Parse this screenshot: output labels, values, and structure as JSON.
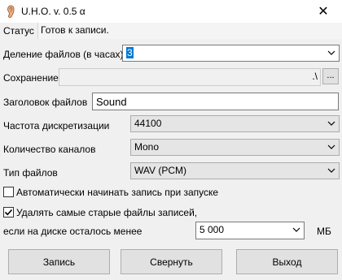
{
  "window": {
    "title": "U.H.O. v. 0.5 α",
    "close_glyph": "✕",
    "app_icon": "ear-icon"
  },
  "status": {
    "label": "Статус",
    "value": "Готов к записи."
  },
  "split": {
    "label": "Деление файлов (в часах)",
    "value": "3"
  },
  "save": {
    "label": "Сохранение",
    "path": ".\\",
    "browse_label": "..."
  },
  "header": {
    "label": "Заголовок файлов",
    "value": "Sound"
  },
  "sample_rate": {
    "label": "Частота дискретизации",
    "value": "44100"
  },
  "channels": {
    "label": "Количество каналов",
    "value": "Mono"
  },
  "file_type": {
    "label": "Тип файлов",
    "value": "WAV (PCM)"
  },
  "autostart": {
    "label": "Автоматически начинать запись при запуске",
    "checked": false
  },
  "delete_old": {
    "label": "Удалять самые старые файлы записей,",
    "checked": true
  },
  "disk": {
    "label": "если на диске осталось менее",
    "value": "5 000",
    "unit": "МБ"
  },
  "buttons": {
    "record": "Запись",
    "minimize": "Свернуть",
    "exit": "Выход"
  },
  "colors": {
    "selection": "#0078d7",
    "window_bg": "#f0f0f0",
    "button_bg": "#e1e1e1"
  }
}
